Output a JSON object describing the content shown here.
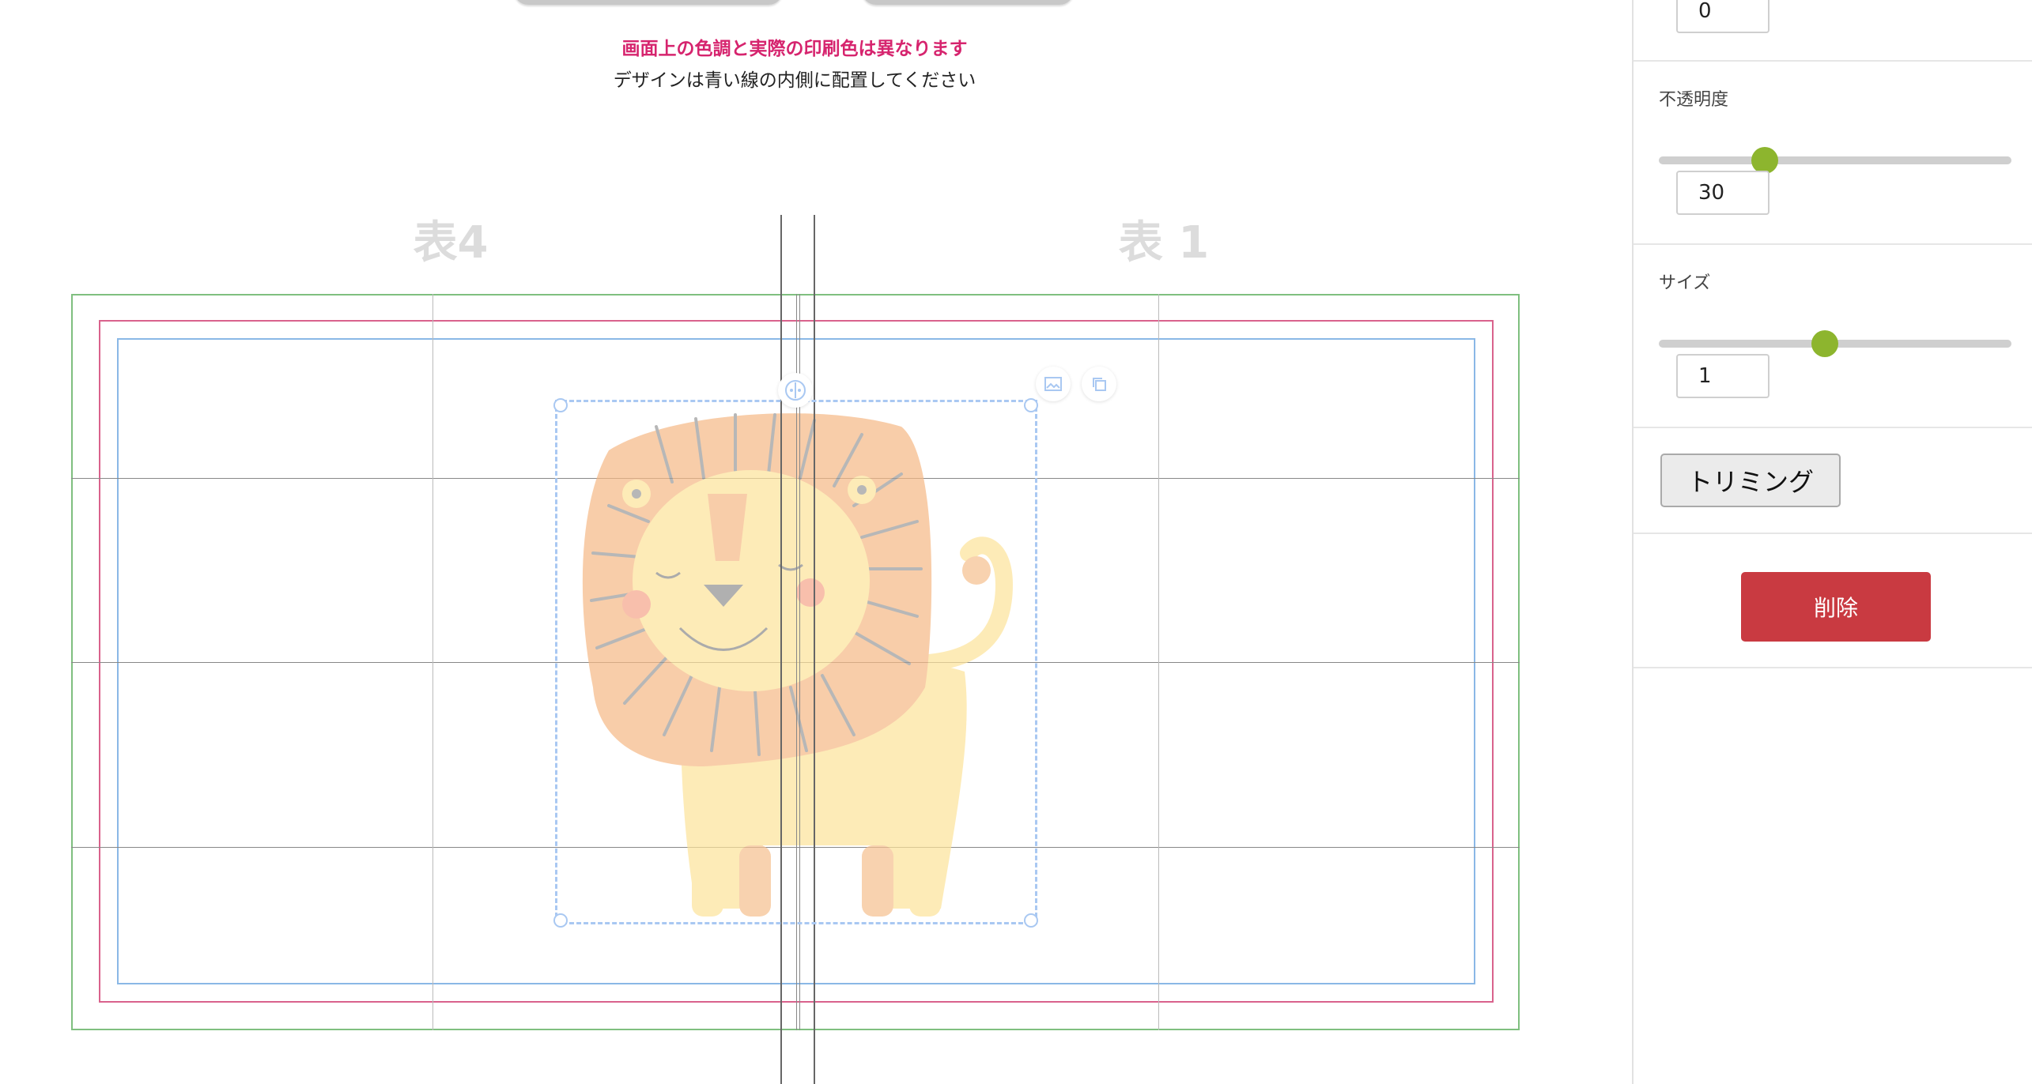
{
  "notices": {
    "color_warning": "画面上の色調と実際の印刷色は異なります",
    "placement_hint": "デザインは青い線の内側に配置してください"
  },
  "cover_labels": {
    "back": "表4",
    "front": "表 1"
  },
  "colors": {
    "warning": "#d6246e",
    "trim_line": "#7fbf7f",
    "bleed_line": "#d9628c",
    "safe_line": "#8ab8e6",
    "slider_accent": "#8db52e",
    "delete_bg": "#c93a41"
  },
  "canvas": {
    "selected_image": "lion-illustration",
    "toolbar_icons": [
      "image-icon",
      "copy-icon",
      "move-icon"
    ]
  },
  "panel": {
    "previous_field_value": "0",
    "opacity": {
      "label": "不透明度",
      "value": "30",
      "level": 0.3
    },
    "size": {
      "label": "サイズ",
      "value": "1",
      "level": 0.47
    },
    "trim_button": "トリミング",
    "delete_button": "削除"
  }
}
